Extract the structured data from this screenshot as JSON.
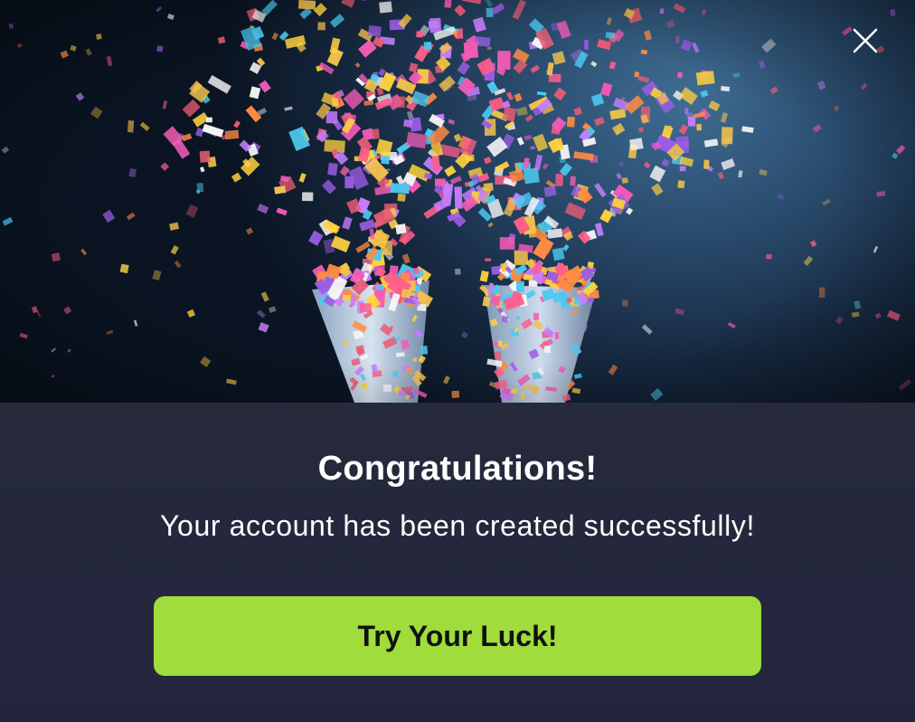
{
  "modal": {
    "title": "Congratulations!",
    "message": "Your account has been created successfully!",
    "cta_label": "Try Your Luck!",
    "close_icon": "close-icon"
  },
  "hero": {
    "image": "confetti-party-poppers",
    "confetti_colors": [
      "#f2c14e",
      "#e85d75",
      "#c77dff",
      "#4cc9f0",
      "#ff8c42",
      "#f7f7f7",
      "#ff5e8a",
      "#ffd23f",
      "#9b5de5",
      "#f15bb5"
    ]
  },
  "colors": {
    "cta_background": "#9fdc3c",
    "panel_background": "#23263a",
    "text": "#ffffff"
  }
}
